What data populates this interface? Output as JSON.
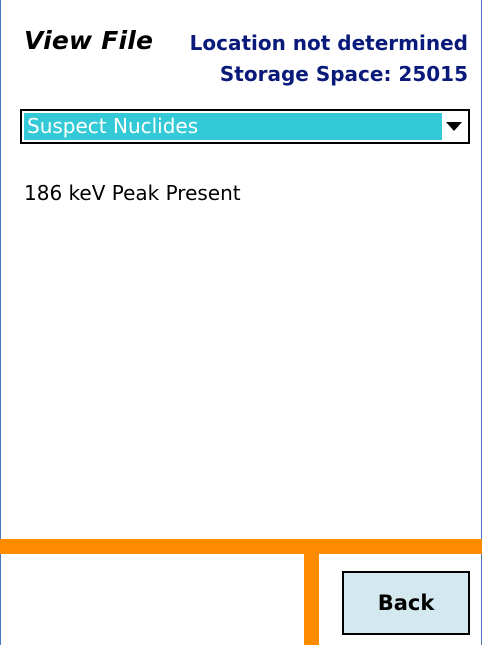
{
  "header": {
    "title": "View File",
    "location": "Location not determined",
    "storage": "Storage Space: 25015"
  },
  "dropdown": {
    "selected": "Suspect Nuclides",
    "icon": "chevron-down-icon"
  },
  "content": {
    "message": "186 keV Peak Present"
  },
  "footer": {
    "back_label": "Back"
  },
  "colors": {
    "accent_orange": "#ff8c00",
    "selection_cyan": "#33c9d6",
    "heading_navy": "#0a1a7a",
    "button_bg": "#d3e8ef",
    "frame_blue": "#4a78c8"
  }
}
